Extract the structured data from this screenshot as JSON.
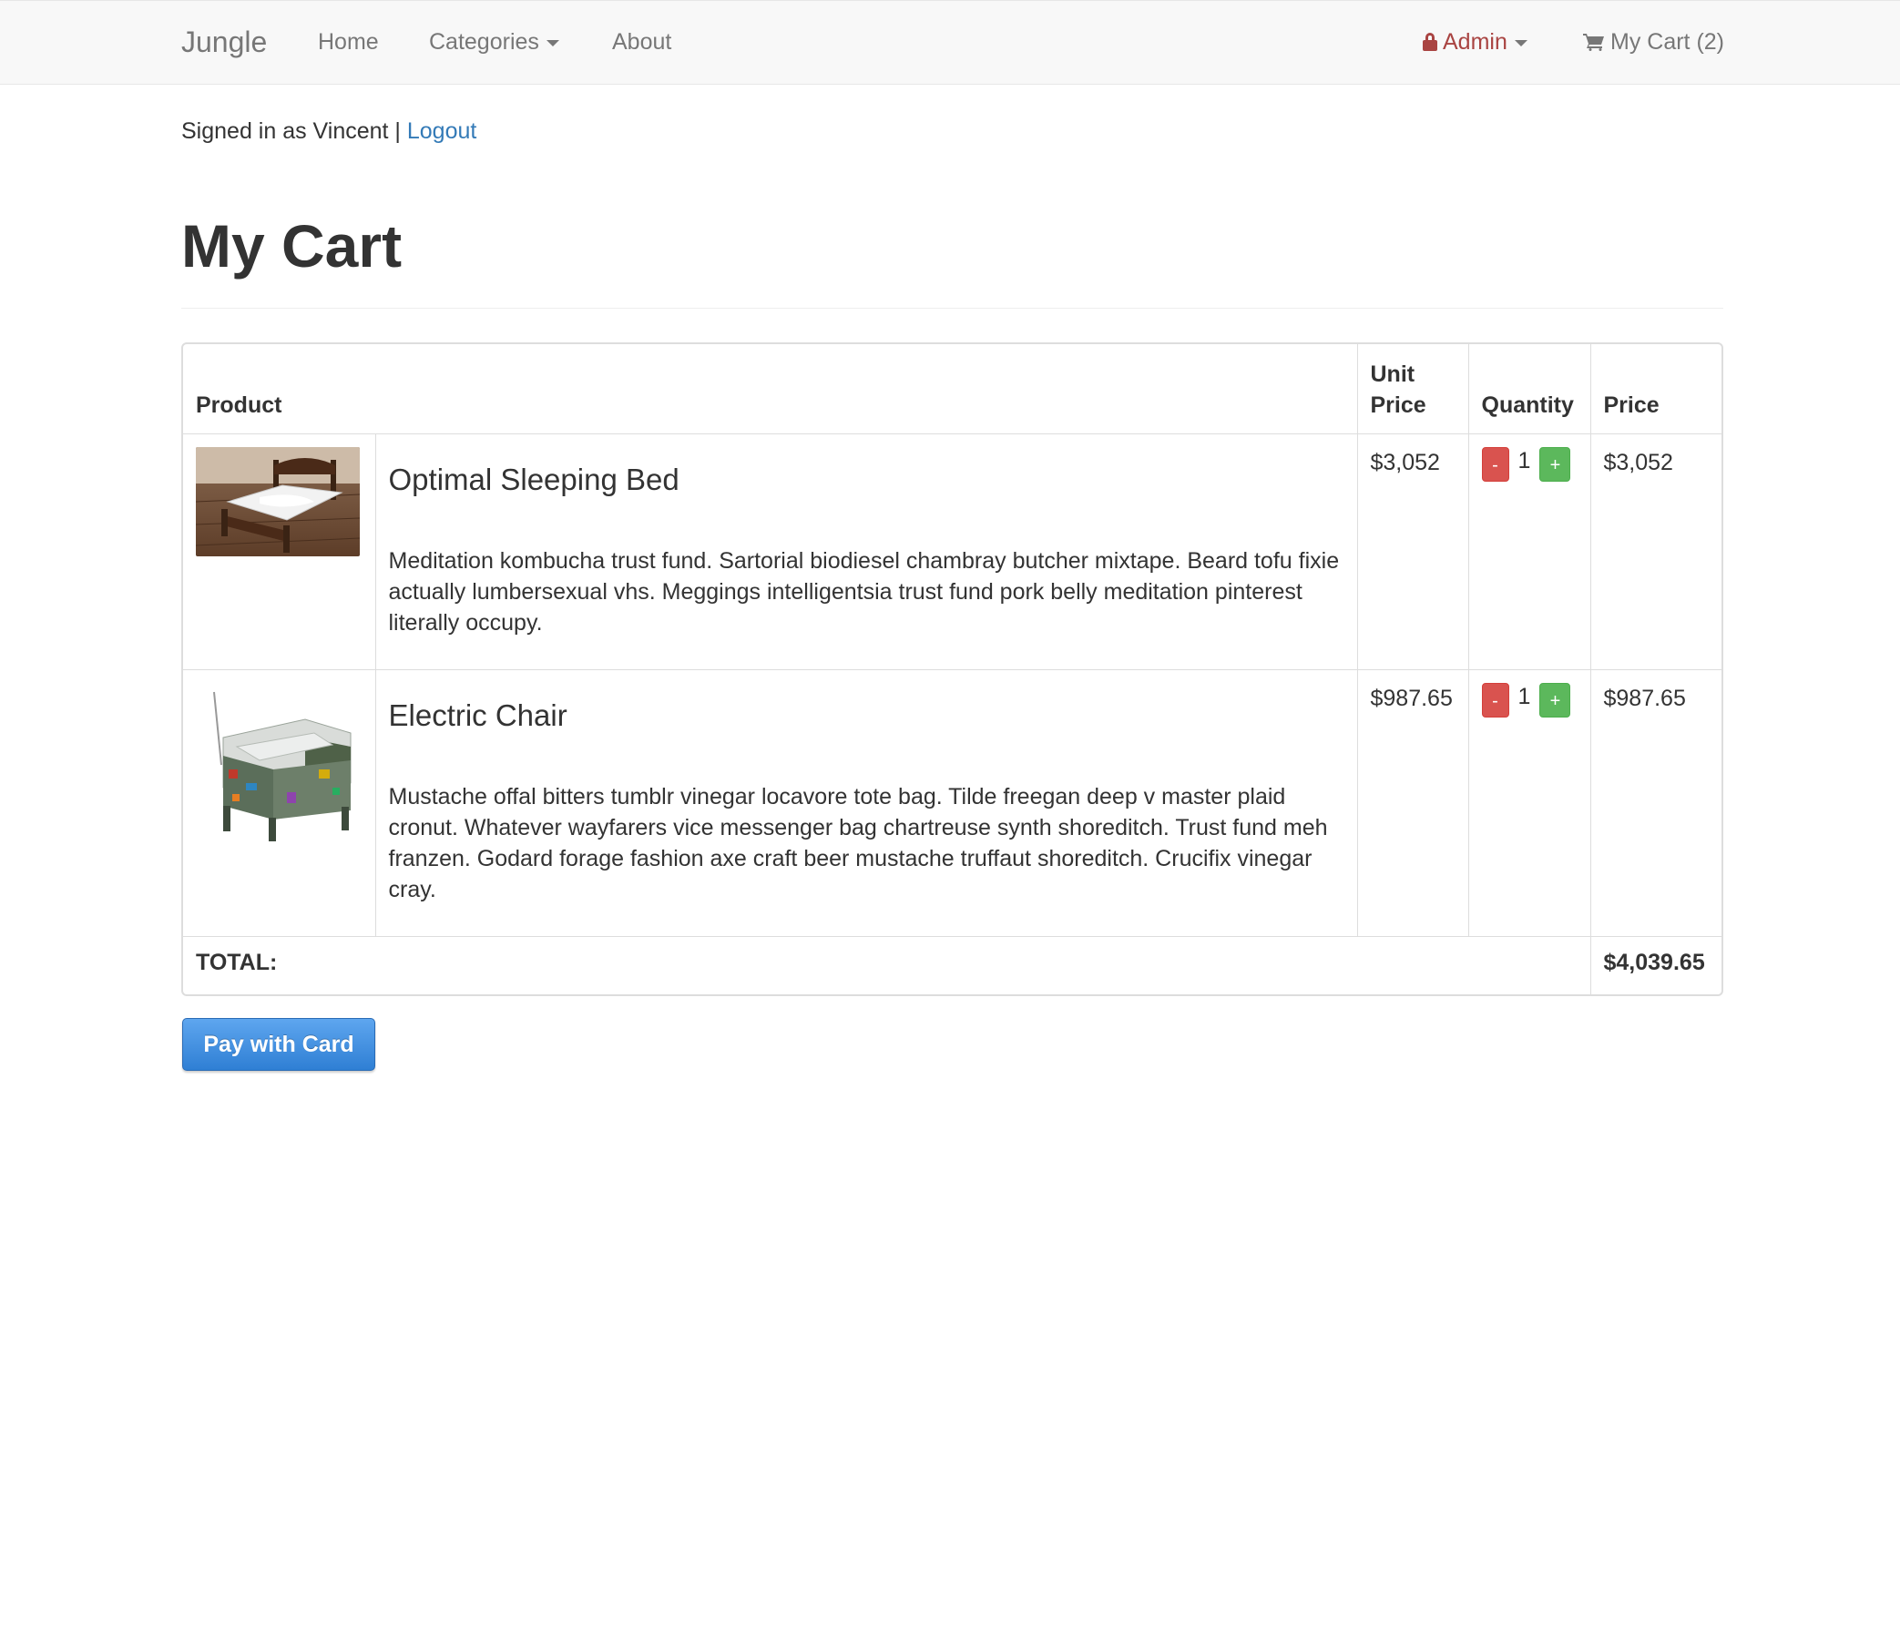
{
  "navbar": {
    "brand": "Jungle",
    "links": {
      "home": "Home",
      "categories": "Categories",
      "about": "About",
      "admin": "Admin",
      "cart": "My Cart (2)"
    },
    "icons": {
      "admin": "lock-icon",
      "cart": "shopping-cart-icon",
      "dropdown": "caret-down-icon"
    },
    "colors": {
      "admin": "#a94442",
      "link": "#777777"
    }
  },
  "session": {
    "signed_in_text": "Signed in as Vincent |",
    "logout_label": "Logout"
  },
  "page": {
    "title": "My Cart"
  },
  "cart": {
    "headers": {
      "product": "Product",
      "unit_price_line1": "Unit",
      "unit_price_line2": "Price",
      "quantity": "Quantity",
      "price": "Price"
    },
    "items": [
      {
        "name": "Optimal Sleeping Bed",
        "description": "Meditation kombucha trust fund. Sartorial biodiesel chambray butcher mixtape. Beard tofu fixie actually lumbersexual vhs. Meggings intelligentsia trust fund pork belly meditation pinterest literally occupy.",
        "unit_price": "$3,052",
        "quantity": "1",
        "price": "$3,052",
        "image": "bed-photo"
      },
      {
        "name": "Electric Chair",
        "description": "Mustache offal bitters tumblr vinegar locavore tote bag. Tilde freegan deep v master plaid cronut. Whatever wayfarers vice messenger bag chartreuse synth shoreditch. Trust fund meh franzen. Godard forage fashion axe craft beer mustache truffaut shoreditch. Crucifix vinegar cray.",
        "unit_price": "$987.65",
        "quantity": "1",
        "price": "$987.65",
        "image": "circuit-board-armchair-photo"
      }
    ],
    "qty_minus_label": "-",
    "qty_plus_label": "+",
    "total_label": "TOTAL:",
    "total_value": "$4,039.65"
  },
  "checkout": {
    "pay_button_label": "Pay with Card",
    "colors": {
      "pay_button": "#3b8ddf",
      "minus_button": "#d9534f",
      "plus_button": "#5cb85c"
    }
  }
}
